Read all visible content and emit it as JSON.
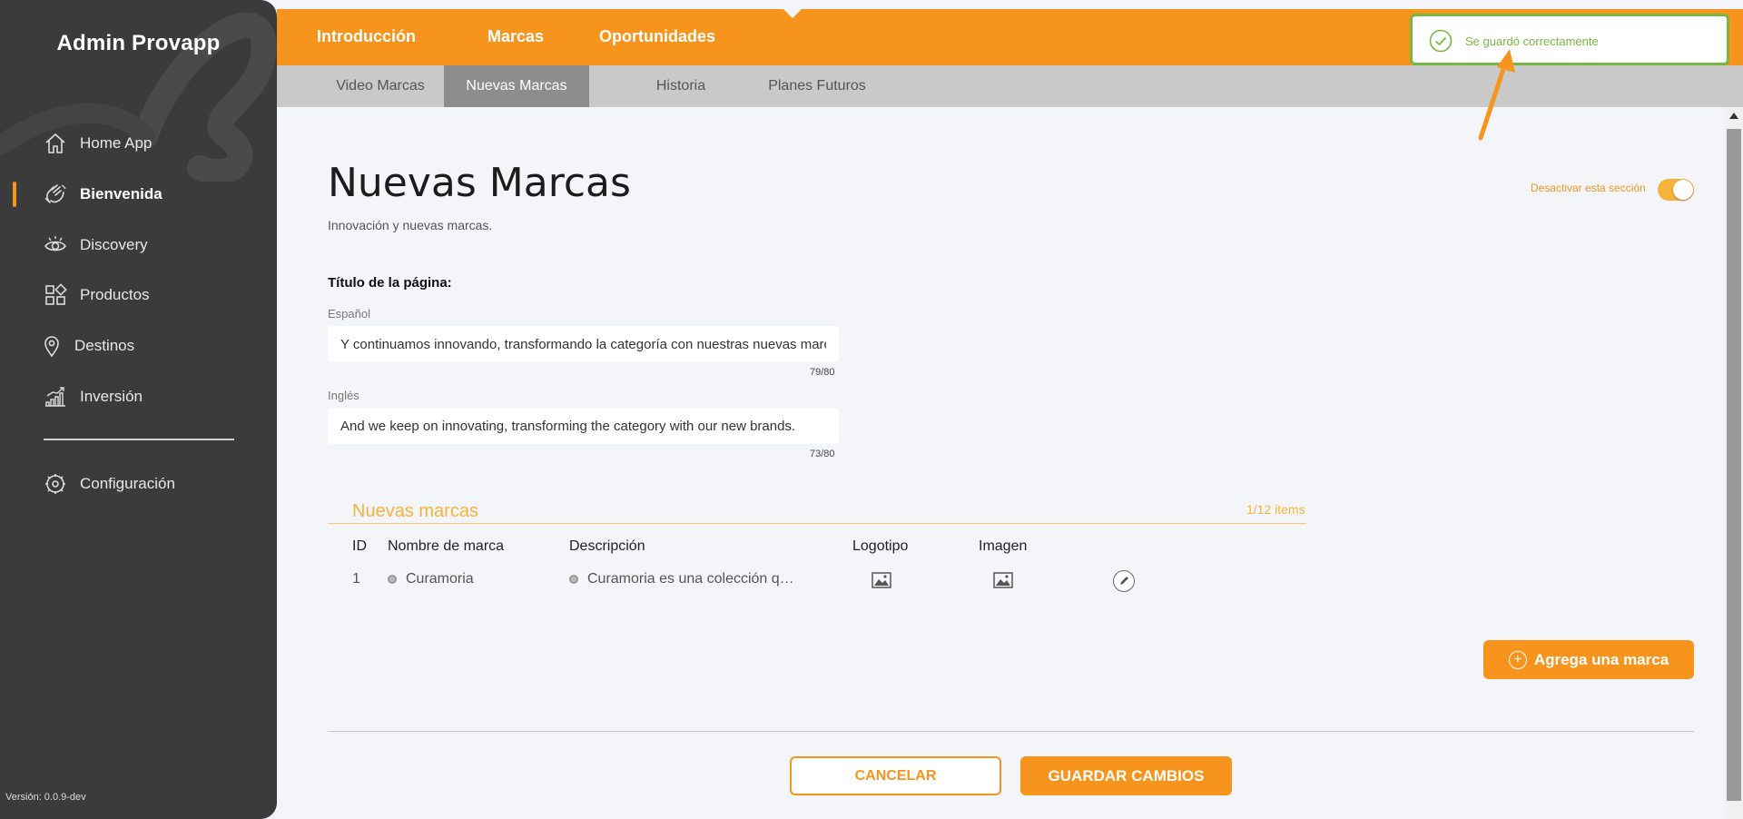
{
  "sidebar": {
    "brand": "Admin Provapp",
    "items": [
      {
        "label": "Home App",
        "icon": "home-icon"
      },
      {
        "label": "Bienvenida",
        "icon": "waving-hand-icon",
        "active": true
      },
      {
        "label": "Discovery",
        "icon": "eye-icon"
      },
      {
        "label": "Productos",
        "icon": "grid-shapes-icon"
      },
      {
        "label": "Destinos",
        "icon": "location-pin-icon"
      },
      {
        "label": "Inversión",
        "icon": "bar-chart-icon"
      }
    ],
    "settings": {
      "label": "Configuración",
      "icon": "gear-icon"
    },
    "version": "Versión: 0.0.9-dev"
  },
  "topnav": {
    "tabs": [
      "Introducción",
      "Marcas",
      "Oportunidades"
    ],
    "active": "Marcas"
  },
  "subnav": {
    "tabs": [
      "Video Marcas",
      "Nuevas Marcas",
      "Historia",
      "Planes Futuros"
    ],
    "active": "Nuevas Marcas"
  },
  "page": {
    "title": "Nuevas Marcas",
    "subtitle": "Innovación y nuevas marcas.",
    "toggle_label": "Desactivar esta sección",
    "toggle_on": true
  },
  "form": {
    "heading": "Título de la página:",
    "spanish_label": "Español",
    "spanish_value": "Y continuamos innovando, transformando la categoría con nuestras nuevas marcas.",
    "spanish_counter": "79/80",
    "english_label": "Inglés",
    "english_value": "And we keep on innovating, transforming the category with our new brands.",
    "english_counter": "73/80"
  },
  "brands": {
    "title": "Nuevas marcas",
    "count": "1/12 items",
    "columns": [
      "ID",
      "Nombre de marca",
      "Descripción",
      "Logotipo",
      "Imagen"
    ],
    "rows": [
      {
        "id": "1",
        "name": "Curamoria",
        "description": "Curamoria es una colección q…"
      }
    ],
    "add_button": "Agrega una marca"
  },
  "actions": {
    "cancel": "CANCELAR",
    "save": "GUARDAR CAMBIOS"
  },
  "toast": {
    "message": "Se guardó correctamente",
    "icon": "check-circle-icon"
  },
  "colors": {
    "accent": "#f7941d",
    "sidebar": "#3b3b3b",
    "success": "#77b843"
  }
}
